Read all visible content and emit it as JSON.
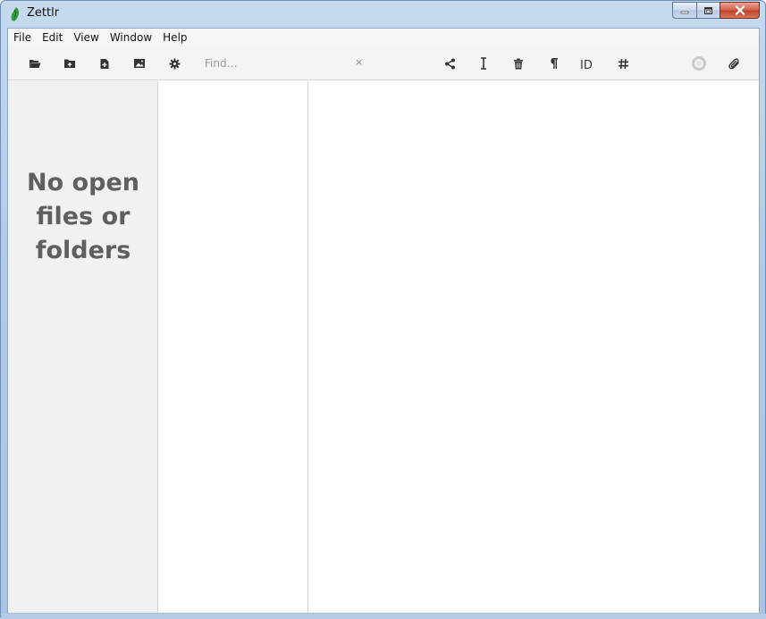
{
  "window": {
    "title": "Zettlr",
    "controls": {
      "minimize": "minimize-icon",
      "maximize": "maximize-icon",
      "close": "close-icon"
    }
  },
  "menu": [
    "File",
    "Edit",
    "View",
    "Window",
    "Help"
  ],
  "toolbar": {
    "left_icons": [
      "folder-open-icon",
      "new-folder-icon",
      "new-file-icon",
      "image-icon",
      "gear-icon"
    ],
    "search": {
      "placeholder": "Find…",
      "value": "",
      "clear_label": "×"
    },
    "right_icons": [
      "share-icon",
      "text-cursor-icon",
      "trash-icon",
      "pilcrow-icon",
      "id-icon",
      "hashtag-icon",
      "pomodoro-icon",
      "attachment-icon"
    ],
    "id_label": "ID"
  },
  "sidebar": {
    "empty_lines": [
      "No open",
      "files or",
      "folders"
    ]
  },
  "colors": {
    "icon": "#333333",
    "muted_text": "#5f5f5f",
    "sidebar_bg": "#f1f1f1"
  }
}
